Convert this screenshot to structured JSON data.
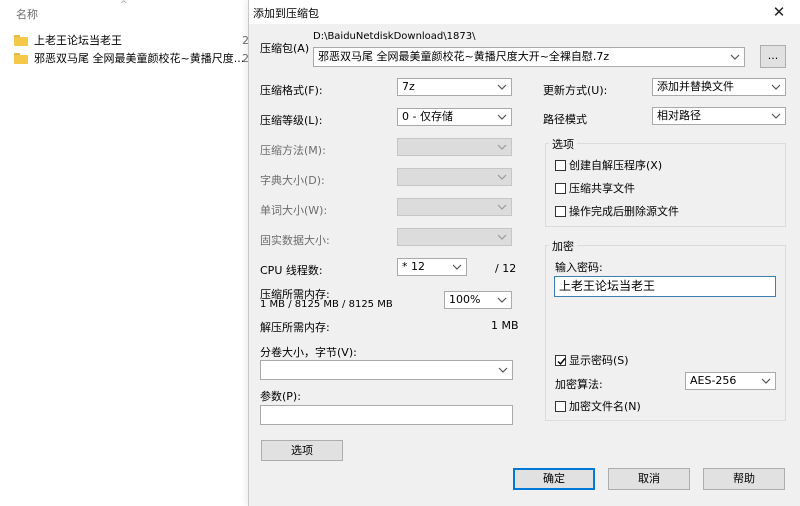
{
  "explorer": {
    "header_name": "名称",
    "items": [
      {
        "name": "上老王论坛当老王",
        "col2": "2"
      },
      {
        "name": "邪恶双马尾 全网最美童颜校花~黄播尺度...",
        "col2": "2"
      }
    ]
  },
  "dialog": {
    "title": "添加到压缩包",
    "archive": {
      "label": "压缩包(A)",
      "path": "D:\\BaiduNetdiskDownload\\1873\\",
      "filename": "邪恶双马尾 全网最美童颜校花~黄播尺度大开~全裸自慰.7z",
      "browse_label": "..."
    },
    "left": {
      "format": {
        "label": "压缩格式(F):",
        "value": "7z"
      },
      "level": {
        "label": "压缩等级(L):",
        "value": "0 - 仅存储"
      },
      "method": {
        "label": "压缩方法(M):"
      },
      "dict": {
        "label": "字典大小(D):"
      },
      "word": {
        "label": "单词大小(W):"
      },
      "solid": {
        "label": "固实数据大小:"
      },
      "threads": {
        "label": "CPU 线程数:",
        "value": "* 12",
        "total": "/ 12"
      },
      "mem_compress": {
        "label": "压缩所需内存:",
        "detail": "1 MB / 8125 MB / 8125 MB",
        "percent": "100%"
      },
      "mem_decompress": {
        "label": "解压所需内存:",
        "value": "1 MB"
      },
      "volume": {
        "label": "分卷大小，字节(V):",
        "value": ""
      },
      "params": {
        "label": "参数(P):",
        "value": ""
      },
      "options_button": "选项"
    },
    "right": {
      "update": {
        "label": "更新方式(U):",
        "value": "添加并替换文件"
      },
      "path_mode": {
        "label": "路径模式",
        "value": "相对路径"
      },
      "options_group": {
        "title": "选项",
        "sfx": "创建自解压程序(X)",
        "shared": "压缩共享文件",
        "delete_after": "操作完成后删除源文件"
      },
      "encryption_group": {
        "title": "加密",
        "password_label": "输入密码:",
        "password_value": "上老王论坛当老王",
        "show_password": "显示密码(S)",
        "method_label": "加密算法:",
        "method_value": "AES-256",
        "encrypt_names": "加密文件名(N)"
      }
    },
    "buttons": {
      "ok": "确定",
      "cancel": "取消",
      "help": "帮助"
    }
  }
}
